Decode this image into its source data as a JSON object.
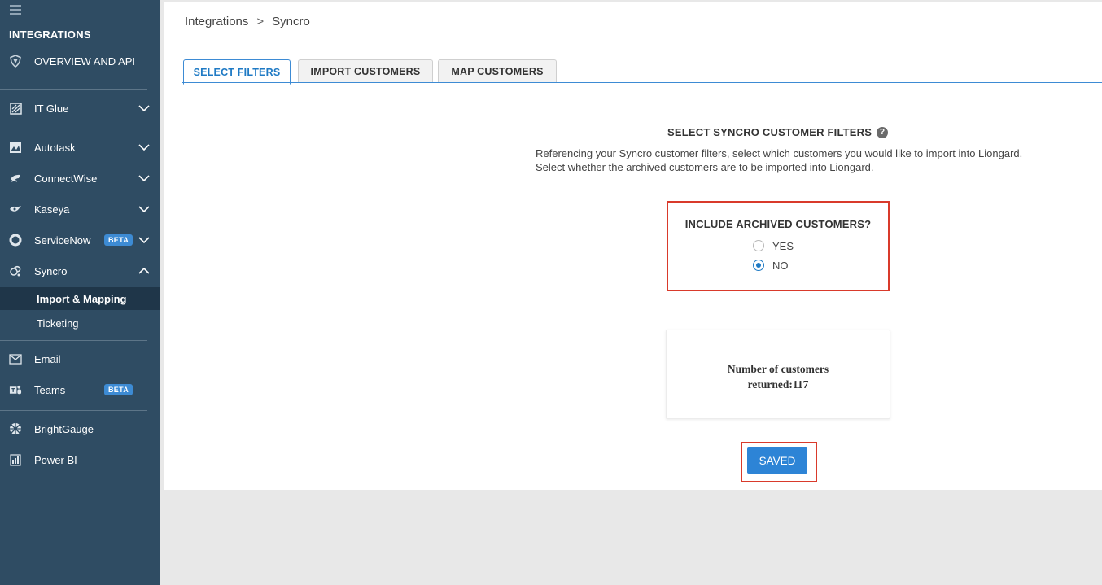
{
  "sidebar": {
    "title": "INTEGRATIONS",
    "overview": "OVERVIEW AND API",
    "items": [
      {
        "label": "IT Glue",
        "icon": "itglue-icon"
      },
      {
        "label": "Autotask",
        "icon": "autotask-icon"
      },
      {
        "label": "ConnectWise",
        "icon": "connectwise-icon"
      },
      {
        "label": "Kaseya",
        "icon": "kaseya-icon"
      },
      {
        "label": "ServiceNow",
        "icon": "servicenow-icon",
        "badge": "BETA"
      },
      {
        "label": "Syncro",
        "icon": "syncro-icon"
      }
    ],
    "syncro_sub": {
      "import_mapping": "Import & Mapping",
      "ticketing": "Ticketing"
    },
    "email": "Email",
    "teams": "Teams",
    "teams_badge": "BETA",
    "brightgauge": "BrightGauge",
    "powerbi": "Power BI"
  },
  "breadcrumb": {
    "root": "Integrations",
    "sep": ">",
    "current": "Syncro"
  },
  "tabs": [
    {
      "label": "SELECT FILTERS",
      "active": true
    },
    {
      "label": "IMPORT CUSTOMERS",
      "active": false
    },
    {
      "label": "MAP CUSTOMERS",
      "active": false
    }
  ],
  "filters": {
    "title": "SELECT SYNCRO CUSTOMER FILTERS",
    "help": "?",
    "description": "Referencing your Syncro customer filters, select which customers you would like to import into Liongard. Select whether the archived customers are to be imported into Liongard."
  },
  "archived": {
    "question": "INCLUDE ARCHIVED CUSTOMERS?",
    "options": [
      {
        "label": "YES",
        "checked": false
      },
      {
        "label": "NO",
        "checked": true
      }
    ]
  },
  "count": {
    "line1": "Number of customers",
    "line2": "returned:117"
  },
  "save_button": "SAVED",
  "colors": {
    "sidebar_bg": "#2f4c63",
    "sidebar_active": "#1f3649",
    "accent": "#2d84d6",
    "highlight": "#d93a2b"
  }
}
